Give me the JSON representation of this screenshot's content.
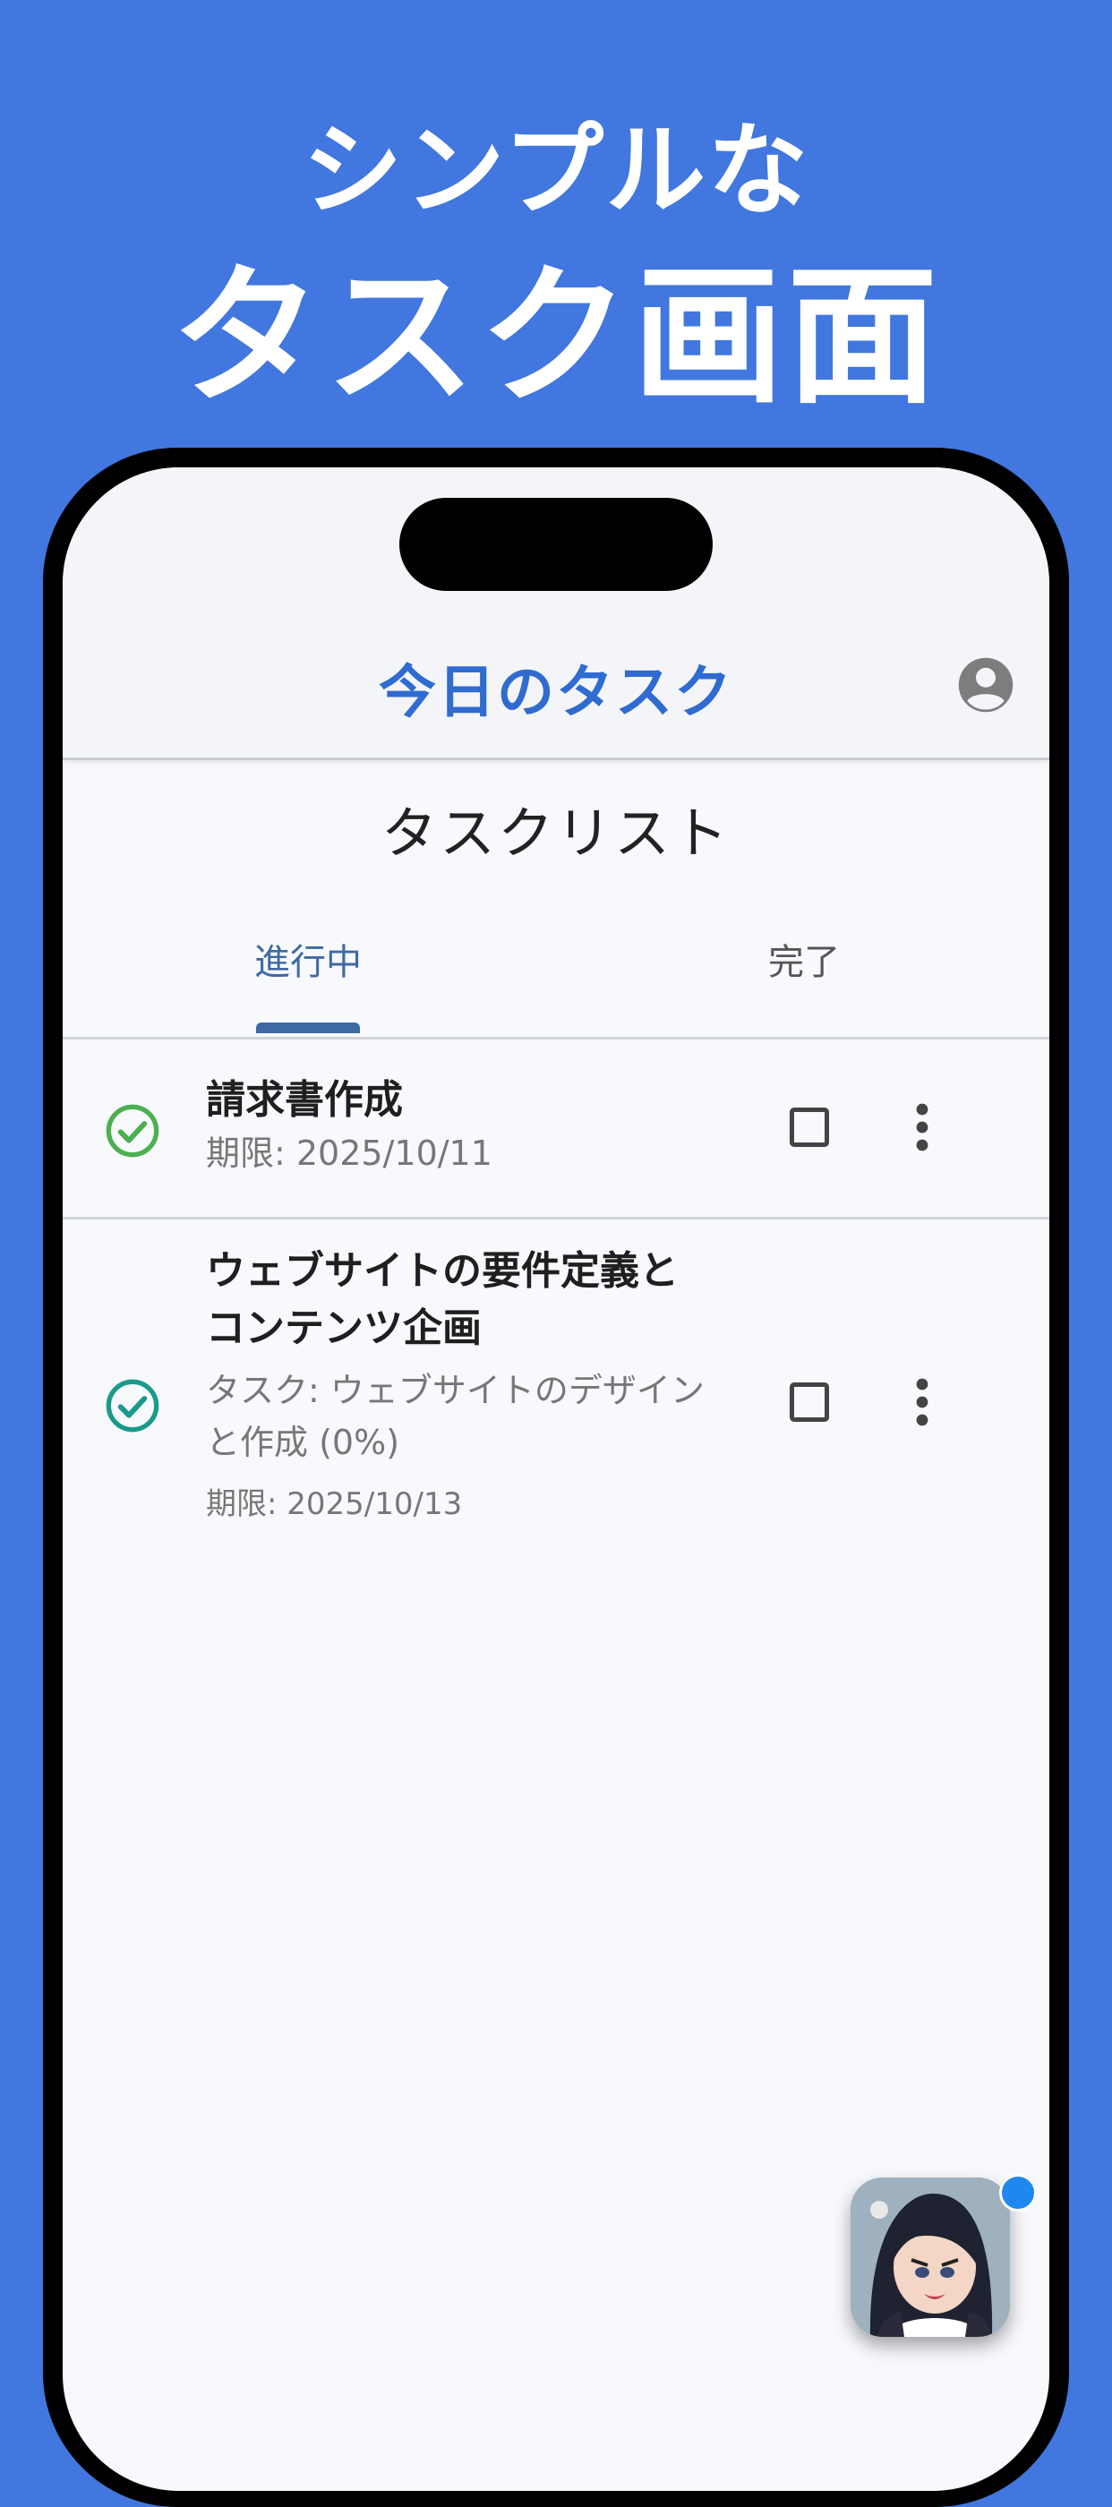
{
  "promo": {
    "line1": "シンプルな",
    "line2": "タスク画面"
  },
  "app": {
    "title": "今日のタスク",
    "page_title": "タスクリスト"
  },
  "tabs": [
    {
      "label": "進行中",
      "active": true
    },
    {
      "label": "完了",
      "active": false
    }
  ],
  "tasks": [
    {
      "title": "請求書作成",
      "due": "期限: 2025/10/11",
      "status_icon_color": "#4caf50"
    },
    {
      "title": "ウェブサイトの要件定義とコンテンツ企画",
      "parent": "タスク: ウェブサイトのデザインと作成 (0%)",
      "due": "期限: 2025/10/13",
      "status_icon_color": "#1a9a8a"
    }
  ],
  "colors": {
    "background": "#4177de",
    "accent": "#2f6bd1",
    "tab_active": "#3f6aa3"
  },
  "icons": [
    "account-circle-icon",
    "check-circle-icon",
    "checkbox-icon",
    "more-vert-icon",
    "assistant-avatar"
  ]
}
